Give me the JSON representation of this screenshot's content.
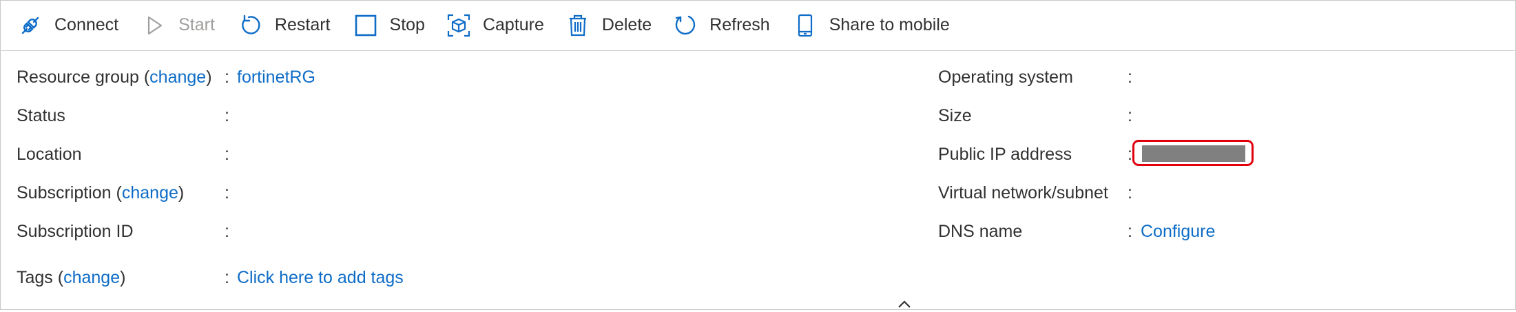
{
  "toolbar": {
    "connect": "Connect",
    "start": "Start",
    "restart": "Restart",
    "stop": "Stop",
    "capture": "Capture",
    "delete": "Delete",
    "refresh": "Refresh",
    "share": "Share to mobile"
  },
  "colors": {
    "link": "#0e6cc7",
    "highlight_border": "#e0000e",
    "redaction": "#808080",
    "disabled": "#a19f9d"
  },
  "essentials": {
    "left": {
      "resource_group": {
        "label": "Resource group",
        "change": "change",
        "value": "fortinetRG"
      },
      "status": {
        "label": "Status",
        "value": ""
      },
      "location": {
        "label": "Location",
        "value": ""
      },
      "subscription": {
        "label": "Subscription",
        "change": "change",
        "value": ""
      },
      "subscription_id": {
        "label": "Subscription ID",
        "value": ""
      },
      "tags": {
        "label": "Tags",
        "change": "change",
        "value": "Click here to add tags"
      }
    },
    "right": {
      "os": {
        "label": "Operating system",
        "value": ""
      },
      "size": {
        "label": "Size",
        "value": ""
      },
      "public_ip": {
        "label": "Public IP address",
        "value": ""
      },
      "vnet": {
        "label": "Virtual network/subnet",
        "value": ""
      },
      "dns": {
        "label": "DNS name",
        "value": "Configure"
      }
    },
    "colon": ":"
  }
}
